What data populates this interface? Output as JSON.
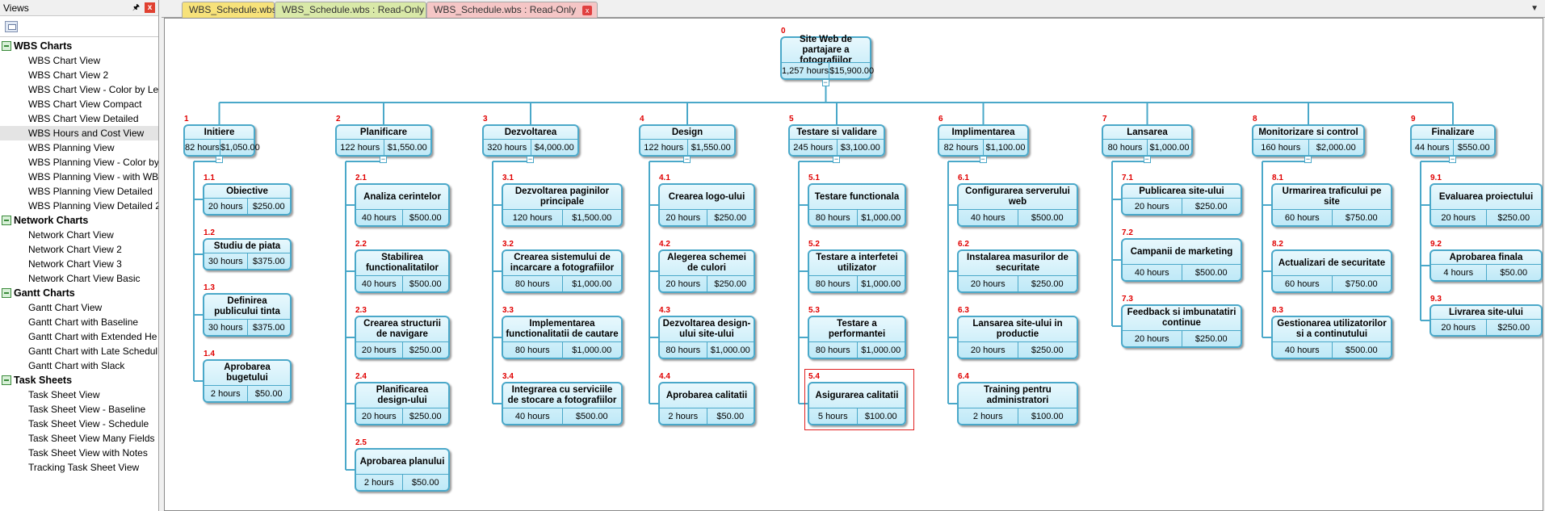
{
  "views_panel": {
    "title": "Views",
    "pin_icon": "pin-icon",
    "close_label": "x",
    "categories": [
      {
        "label": "WBS Charts",
        "icon": "wbs-chart-icon",
        "items": [
          "WBS Chart View",
          "WBS Chart View  2",
          "WBS Chart View - Color by Lev",
          "WBS Chart View Compact",
          "WBS Chart View Detailed",
          "WBS Hours and Cost View",
          "WBS Planning View",
          "WBS Planning View - Color by",
          "WBS Planning View - with WB",
          "WBS Planning View Detailed",
          "WBS Planning View Detailed 2"
        ]
      },
      {
        "label": "Network Charts",
        "icon": "network-chart-icon",
        "items": [
          "Network Chart View",
          "Network Chart View 2",
          "Network Chart View 3",
          "Network Chart View Basic"
        ]
      },
      {
        "label": "Gantt Charts",
        "icon": "gantt-chart-icon",
        "items": [
          "Gantt Chart View",
          "Gantt Chart with Baseline",
          "Gantt Chart with Extended He",
          "Gantt Chart with Late Schedul",
          "Gantt Chart with Slack"
        ]
      },
      {
        "label": "Task Sheets",
        "icon": "task-sheet-icon",
        "items": [
          "Task Sheet View",
          "Task Sheet View - Baseline",
          "Task Sheet View - Schedule",
          "Task Sheet View Many Fields",
          "Task Sheet View with Notes",
          "Tracking Task Sheet View"
        ]
      }
    ],
    "selected_item": "WBS Hours and Cost View"
  },
  "tabs": [
    {
      "label": "WBS_Schedule.wbs",
      "color": "#f7e27a"
    },
    {
      "label": "WBS_Schedule.wbs : Read-Only",
      "color": "#d9e9a8"
    },
    {
      "label": "WBS_Schedule.wbs : Read-Only",
      "color": "#f5c6c6",
      "active": true
    }
  ],
  "tab_close_label": "x",
  "tab_menu_icon": "chevron-down-icon",
  "colors": {
    "node_border": "#4aa8c9",
    "node_fill": "#bfe9f7",
    "wbs_id": "#e00000",
    "selection": "#e02020"
  },
  "wbs": {
    "root": {
      "id": "0",
      "title": "Site Web de partajare a fotografiilor",
      "hours": "1,257 hours",
      "cost": "$15,900.00"
    },
    "phases": [
      {
        "id": "1",
        "title": "Initiere",
        "hours": "82 hours",
        "cost": "$1,050.00",
        "tasks": [
          {
            "id": "1.1",
            "title": "Obiective",
            "hours": "20 hours",
            "cost": "$250.00"
          },
          {
            "id": "1.2",
            "title": "Studiu de piata",
            "hours": "30 hours",
            "cost": "$375.00"
          },
          {
            "id": "1.3",
            "title": "Definirea publicului tinta",
            "hours": "30 hours",
            "cost": "$375.00"
          },
          {
            "id": "1.4",
            "title": "Aprobarea bugetului",
            "hours": "2 hours",
            "cost": "$50.00"
          }
        ]
      },
      {
        "id": "2",
        "title": "Planificare",
        "hours": "122 hours",
        "cost": "$1,550.00",
        "tasks": [
          {
            "id": "2.1",
            "title": "Analiza cerintelor",
            "hours": "40 hours",
            "cost": "$500.00"
          },
          {
            "id": "2.2",
            "title": "Stabilirea functionalitatilor",
            "hours": "40 hours",
            "cost": "$500.00"
          },
          {
            "id": "2.3",
            "title": "Crearea structurii de navigare",
            "hours": "20 hours",
            "cost": "$250.00"
          },
          {
            "id": "2.4",
            "title": "Planificarea design-ului",
            "hours": "20 hours",
            "cost": "$250.00"
          },
          {
            "id": "2.5",
            "title": "Aprobarea planului",
            "hours": "2 hours",
            "cost": "$50.00"
          }
        ]
      },
      {
        "id": "3",
        "title": "Dezvoltarea",
        "hours": "320 hours",
        "cost": "$4,000.00",
        "tasks": [
          {
            "id": "3.1",
            "title": "Dezvoltarea paginilor principale",
            "hours": "120 hours",
            "cost": "$1,500.00"
          },
          {
            "id": "3.2",
            "title": "Crearea sistemului de incarcare a fotografiilor",
            "hours": "80 hours",
            "cost": "$1,000.00"
          },
          {
            "id": "3.3",
            "title": "Implementarea functionalitatii de cautare",
            "hours": "80 hours",
            "cost": "$1,000.00"
          },
          {
            "id": "3.4",
            "title": "Integrarea cu serviciile de stocare a fotografiilor",
            "hours": "40 hours",
            "cost": "$500.00"
          }
        ]
      },
      {
        "id": "4",
        "title": "Design",
        "hours": "122 hours",
        "cost": "$1,550.00",
        "tasks": [
          {
            "id": "4.1",
            "title": "Crearea logo-ului",
            "hours": "20 hours",
            "cost": "$250.00"
          },
          {
            "id": "4.2",
            "title": "Alegerea schemei de culori",
            "hours": "20 hours",
            "cost": "$250.00"
          },
          {
            "id": "4.3",
            "title": "Dezvoltarea design-ului site-ului",
            "hours": "80 hours",
            "cost": "$1,000.00"
          },
          {
            "id": "4.4",
            "title": "Aprobarea calitatii",
            "hours": "2 hours",
            "cost": "$50.00"
          }
        ]
      },
      {
        "id": "5",
        "title": "Testare si validare",
        "hours": "245 hours",
        "cost": "$3,100.00",
        "tasks": [
          {
            "id": "5.1",
            "title": "Testare functionala",
            "hours": "80 hours",
            "cost": "$1,000.00"
          },
          {
            "id": "5.2",
            "title": "Testare a interfetei utilizator",
            "hours": "80 hours",
            "cost": "$1,000.00"
          },
          {
            "id": "5.3",
            "title": "Testare a performantei",
            "hours": "80 hours",
            "cost": "$1,000.00"
          },
          {
            "id": "5.4",
            "title": "Asigurarea calitatii",
            "hours": "5 hours",
            "cost": "$100.00",
            "selected": true
          }
        ]
      },
      {
        "id": "6",
        "title": "Implimentarea",
        "hours": "82 hours",
        "cost": "$1,100.00",
        "tasks": [
          {
            "id": "6.1",
            "title": "Configurarea serverului web",
            "hours": "40 hours",
            "cost": "$500.00"
          },
          {
            "id": "6.2",
            "title": "Instalarea masurilor de securitate",
            "hours": "20 hours",
            "cost": "$250.00"
          },
          {
            "id": "6.3",
            "title": "Lansarea site-ului in productie",
            "hours": "20 hours",
            "cost": "$250.00"
          },
          {
            "id": "6.4",
            "title": "Training pentru administratori",
            "hours": "2 hours",
            "cost": "$100.00"
          }
        ]
      },
      {
        "id": "7",
        "title": "Lansarea",
        "hours": "80 hours",
        "cost": "$1,000.00",
        "tasks": [
          {
            "id": "7.1",
            "title": "Publicarea site-ului",
            "hours": "20 hours",
            "cost": "$250.00"
          },
          {
            "id": "7.2",
            "title": "Campanii de marketing",
            "hours": "40 hours",
            "cost": "$500.00"
          },
          {
            "id": "7.3",
            "title": "Feedback si imbunatatiri continue",
            "hours": "20 hours",
            "cost": "$250.00"
          }
        ]
      },
      {
        "id": "8",
        "title": "Monitorizare si control",
        "hours": "160 hours",
        "cost": "$2,000.00",
        "tasks": [
          {
            "id": "8.1",
            "title": "Urmarirea traficului pe site",
            "hours": "60 hours",
            "cost": "$750.00"
          },
          {
            "id": "8.2",
            "title": "Actualizari de securitate",
            "hours": "60 hours",
            "cost": "$750.00"
          },
          {
            "id": "8.3",
            "title": "Gestionarea utilizatorilor si a continutului",
            "hours": "40 hours",
            "cost": "$500.00"
          }
        ]
      },
      {
        "id": "9",
        "title": "Finalizare",
        "hours": "44 hours",
        "cost": "$550.00",
        "tasks": [
          {
            "id": "9.1",
            "title": "Evaluarea proiectului",
            "hours": "20 hours",
            "cost": "$250.00"
          },
          {
            "id": "9.2",
            "title": "Aprobarea finala",
            "hours": "4 hours",
            "cost": "$50.00"
          },
          {
            "id": "9.3",
            "title": "Livrarea site-ului",
            "hours": "20 hours",
            "cost": "$250.00"
          }
        ]
      }
    ]
  }
}
